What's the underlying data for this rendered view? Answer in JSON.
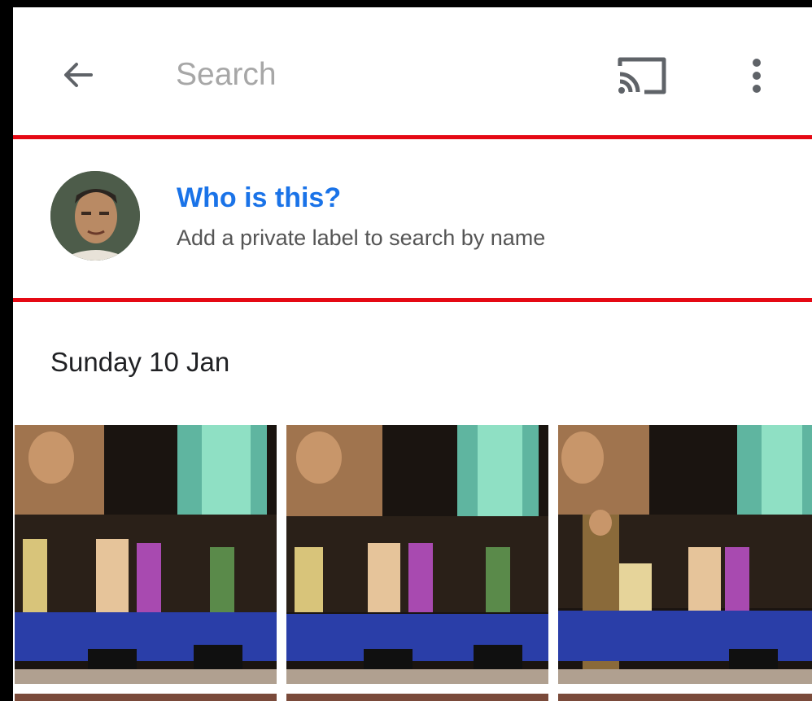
{
  "toolbar": {
    "back_icon": "arrow-left-icon",
    "search_placeholder": "Search",
    "search_value": "",
    "cast_icon": "cast-icon",
    "more_icon": "more-vert-icon"
  },
  "face_suggestion": {
    "title": "Who is this?",
    "subtitle": "Add a private label to search by name",
    "highlight_color": "#e50914",
    "title_color": "#1a73e8"
  },
  "date_section": {
    "label": "Sunday 10 Jan"
  }
}
